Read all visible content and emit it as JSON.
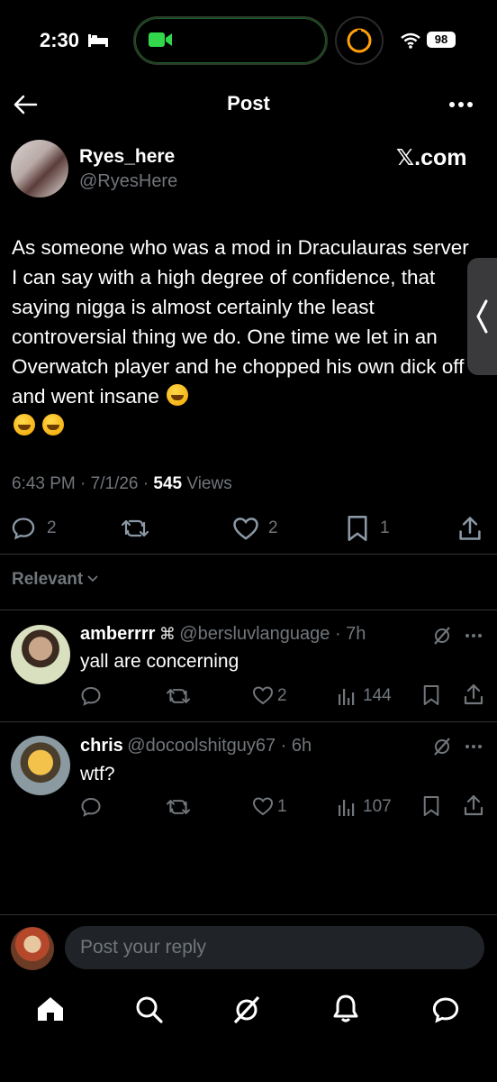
{
  "status_bar": {
    "time": "2:30",
    "battery": "98"
  },
  "header": {
    "title": "Post"
  },
  "post": {
    "author_name": "Ryes_here",
    "author_handle": "@RyesHere",
    "source": "𝕏.com",
    "text": "As someone who was a mod in Draculauras server I can say with a high degree of confidence, that saying nigga is almost certainly the least controversial thing we do. One time we let in an Overwatch player and he chopped his own dick off and went insane",
    "time": "6:43 PM",
    "date": "7/1/26",
    "views_count": "545",
    "views_label": "Views",
    "replies": "2",
    "likes": "2",
    "bookmarks": "1"
  },
  "sort": {
    "label": "Relevant"
  },
  "replies": [
    {
      "name": "amberrrr",
      "handle": "@bersluvlanguage",
      "age": "7h",
      "text": "yall are concerning",
      "likes": "2",
      "views": "144"
    },
    {
      "name": "chris",
      "handle": "@docoolshitguy67",
      "age": "6h",
      "text": "wtf?",
      "likes": "1",
      "views": "107"
    }
  ],
  "composer": {
    "placeholder": "Post your reply"
  },
  "colors": {
    "background": "#000000",
    "secondary_text": "#71767b",
    "divider": "#2f3336"
  }
}
